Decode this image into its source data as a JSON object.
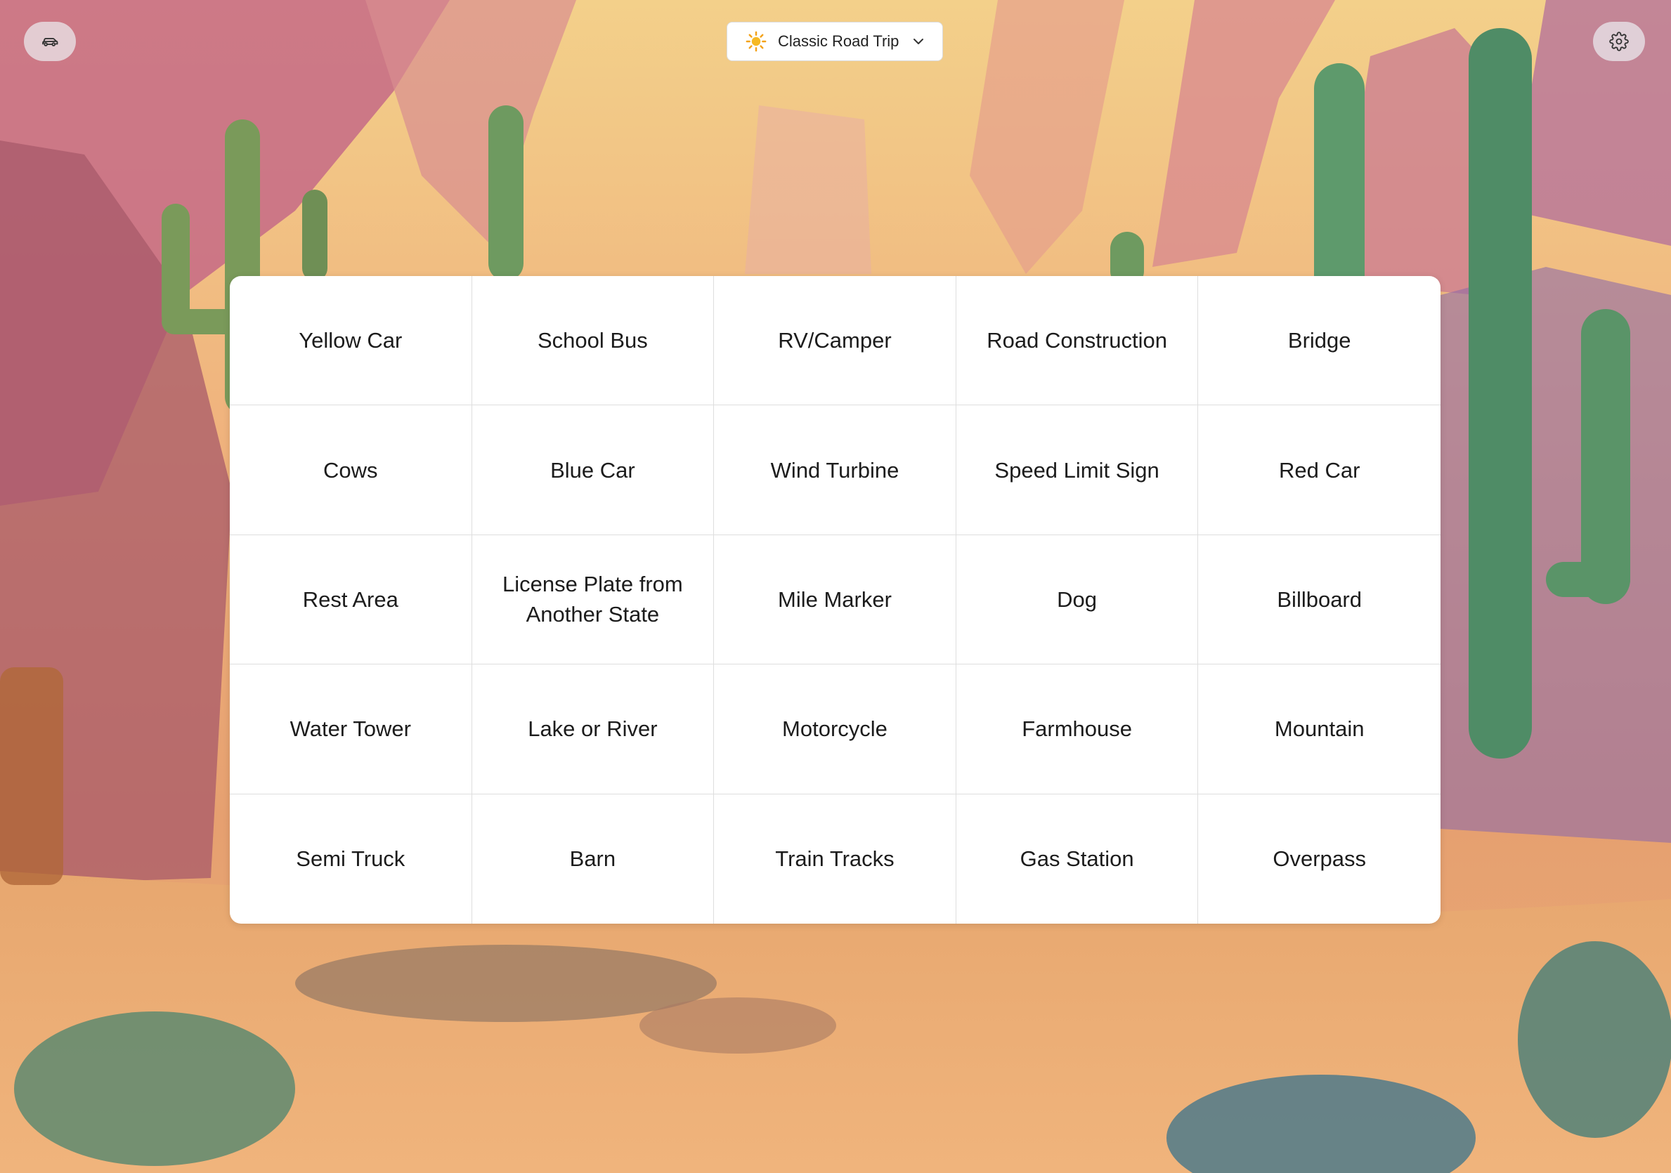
{
  "header": {
    "game_selector": {
      "icon": "sun-icon",
      "label": "Classic Road Trip"
    },
    "left_button_icon": "car-icon",
    "right_button_icon": "gear-icon"
  },
  "board": {
    "cells": [
      "Yellow Car",
      "School Bus",
      "RV/Camper",
      "Road Construction",
      "Bridge",
      "Cows",
      "Blue Car",
      "Wind Turbine",
      "Speed Limit Sign",
      "Red Car",
      "Rest Area",
      "License Plate from Another State",
      "Mile Marker",
      "Dog",
      "Billboard",
      "Water Tower",
      "Lake or River",
      "Motorcycle",
      "Farmhouse",
      "Mountain",
      "Semi Truck",
      "Barn",
      "Train Tracks",
      "Gas Station",
      "Overpass"
    ]
  },
  "colors": {
    "sky": "#f2c67e",
    "cactus": "#5e9a6c",
    "sand": "#e8a870",
    "cell_border": "#dedede"
  }
}
